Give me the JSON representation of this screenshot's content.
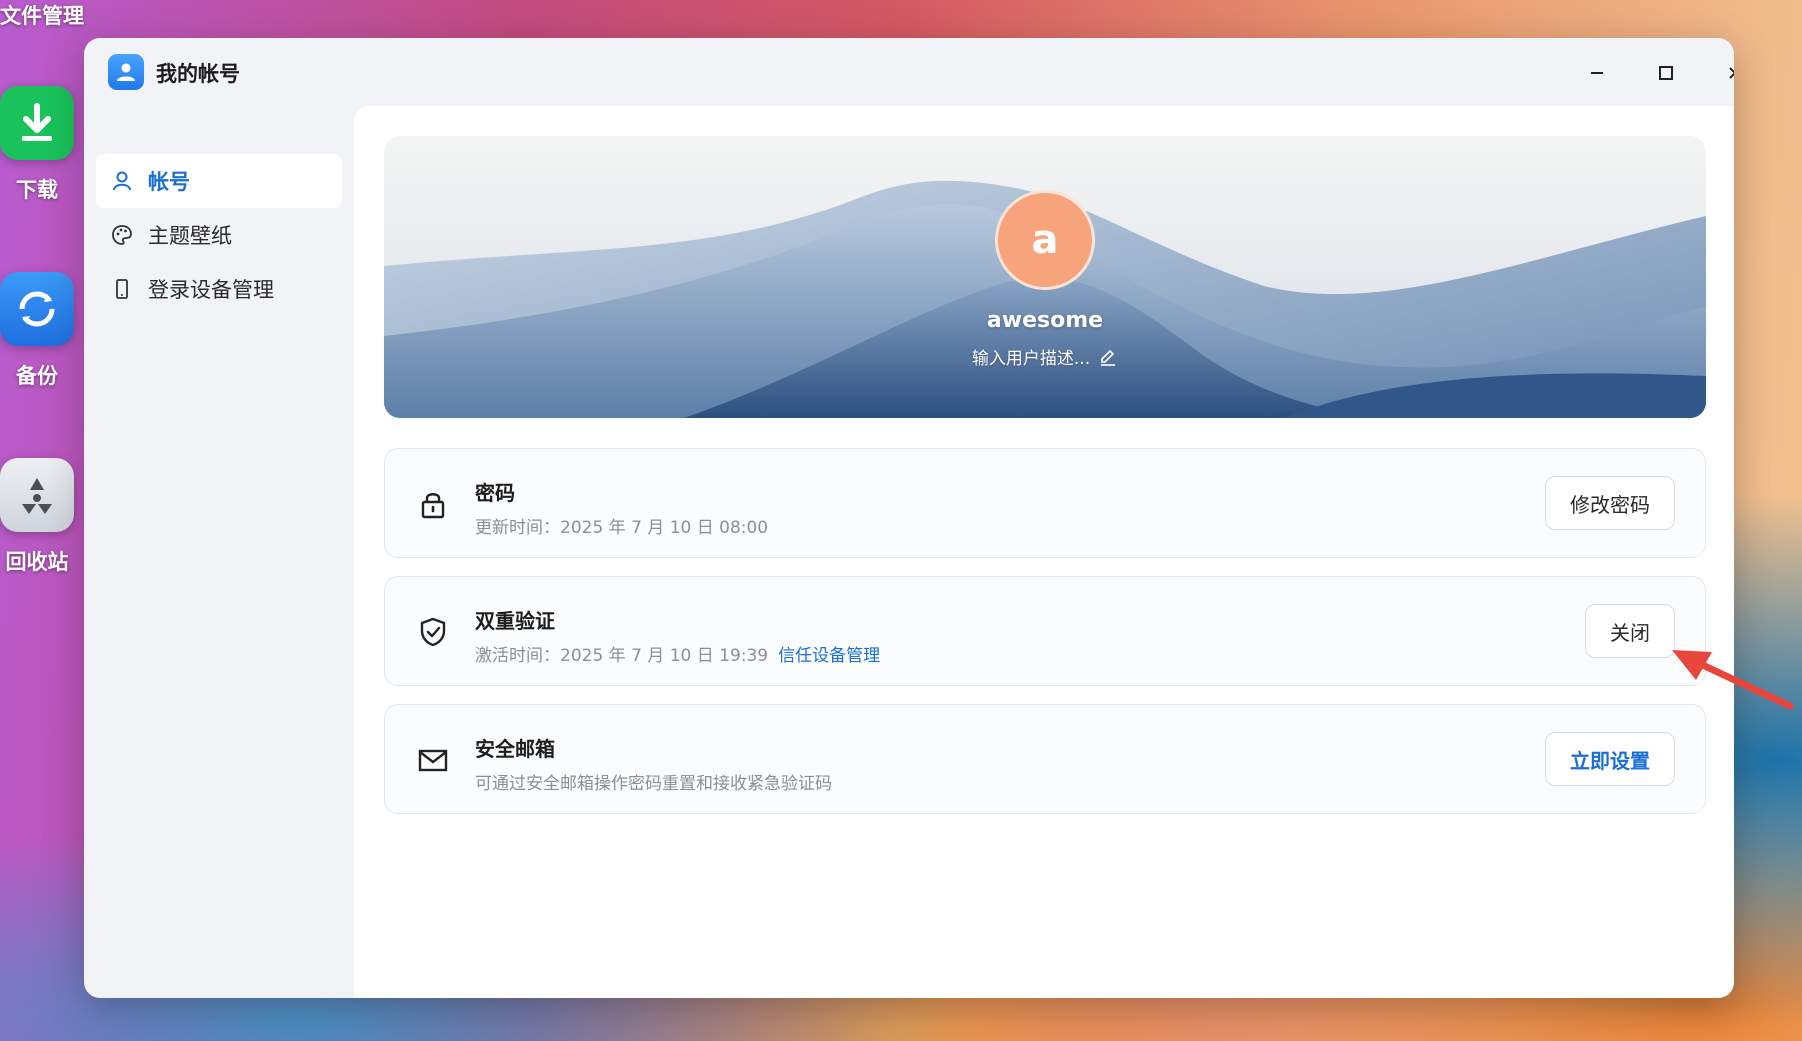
{
  "desktop": {
    "top_label": "文件管理",
    "icons": [
      {
        "label": "下载",
        "icon": "download-icon",
        "color": "#19c25a"
      },
      {
        "label": "备份",
        "icon": "sync-icon",
        "color": "#2b86f0"
      },
      {
        "label": "回收站",
        "icon": "recycle-icon",
        "color": "#d9dde3"
      }
    ]
  },
  "window": {
    "title": "我的帐号",
    "controls": [
      "minimize",
      "maximize",
      "close"
    ]
  },
  "sidebar": {
    "items": [
      {
        "label": "帐号",
        "icon": "user-icon",
        "active": true
      },
      {
        "label": "主题壁纸",
        "icon": "palette-icon",
        "active": false
      },
      {
        "label": "登录设备管理",
        "icon": "phone-icon",
        "active": false
      }
    ]
  },
  "profile": {
    "avatar_letter": "a",
    "username": "awesome",
    "description_placeholder": "输入用户描述..."
  },
  "cards": {
    "password": {
      "title": "密码",
      "subtitle": "更新时间：2025 年 7 月 10 日 08:00",
      "button": "修改密码"
    },
    "two_factor": {
      "title": "双重验证",
      "subtitle": "激活时间：2025 年 7 月 10 日 19:39",
      "link": "信任设备管理",
      "button": "关闭"
    },
    "email": {
      "title": "安全邮箱",
      "subtitle": "可通过安全邮箱操作密码重置和接收紧急验证码",
      "button": "立即设置"
    }
  },
  "colors": {
    "accent": "#1a6fd6",
    "avatar": "#f7a47d",
    "annotation_arrow": "#e8453c"
  }
}
